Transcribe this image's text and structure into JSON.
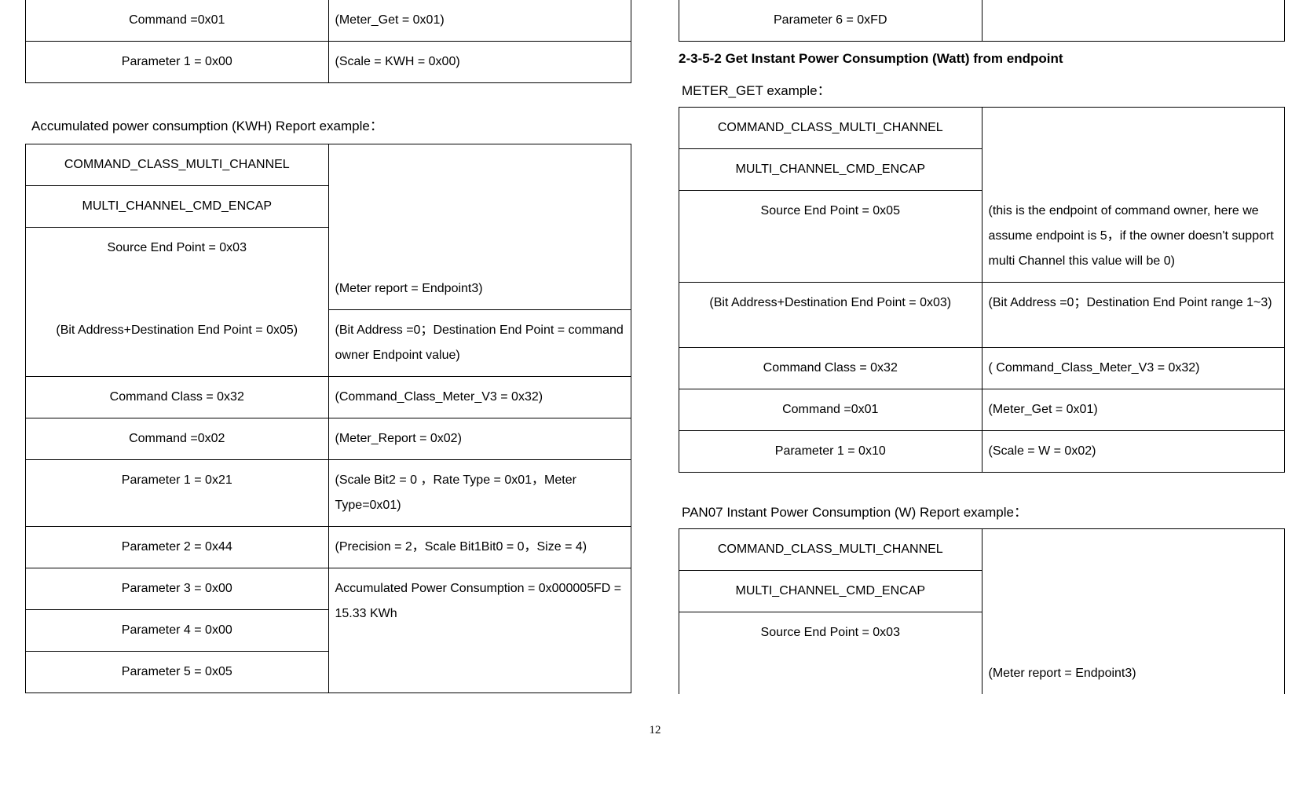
{
  "leftTop": {
    "r1c1": "Command =0x01",
    "r1c2": "(Meter_Get = 0x01)",
    "r2c1": "Parameter 1 = 0x00",
    "r2c2": "(Scale = KWH = 0x00)"
  },
  "leftCaption": "Accumulated power consumption (KWH) Report example：",
  "leftTable": {
    "r1c1": "COMMAND_CLASS_MULTI_CHANNEL",
    "r2c1": "MULTI_CHANNEL_CMD_ENCAP",
    "r3c1": "Source End Point = 0x03",
    "r3c2": "(Meter report = Endpoint3)",
    "r4c1": "(Bit Address+Destination End Point = 0x05)",
    "r4c2": "(Bit Address =0；Destination End Point = command owner Endpoint value)",
    "r5c1": "Command Class = 0x32",
    "r5c2": "(Command_Class_Meter_V3 = 0x32)",
    "r6c1": "Command =0x02",
    "r6c2": "(Meter_Report = 0x02)",
    "r7c1": "Parameter 1 = 0x21",
    "r7c2": "(Scale Bit2 = 0 ，Rate Type = 0x01，Meter Type=0x01)",
    "r8c1": "Parameter 2 = 0x44",
    "r8c2": "(Precision = 2，Scale Bit1Bit0 = 0，Size = 4)",
    "r9c1": "Parameter 3 = 0x00",
    "r9c2": "Accumulated Power Consumption = 0x000005FD = 15.33 KWh",
    "r10c1": "Parameter 4 = 0x00",
    "r11c1": "Parameter 5 = 0x05"
  },
  "rightTop": {
    "r1c1": "Parameter 6 = 0xFD"
  },
  "heading": "2-3-5-2 Get Instant Power Consumption (Watt) from endpoint",
  "subcaption1": "METER_GET example：",
  "rightTable1": {
    "r1c1": "COMMAND_CLASS_MULTI_CHANNEL",
    "r2c1": "MULTI_CHANNEL_CMD_ENCAP",
    "r3c1": "Source End Point = 0x05",
    "r3c2": "(this is the endpoint of command owner, here we assume endpoint is 5，if the owner doesn't support multi Channel this value will be 0)",
    "r4c1": "(Bit Address+Destination End Point = 0x03)",
    "r4c2": "(Bit Address =0；Destination End Point range 1~3)",
    "r5c1": "Command Class = 0x32",
    "r5c2": "( Command_Class_Meter_V3 = 0x32)",
    "r6c1": "Command =0x01",
    "r6c2": "(Meter_Get = 0x01)",
    "r7c1": "Parameter 1 = 0x10",
    "r7c2": "(Scale = W = 0x02)"
  },
  "subcaption2": "PAN07 Instant Power Consumption (W) Report example：",
  "rightTable2": {
    "r1c1": "COMMAND_CLASS_MULTI_CHANNEL",
    "r2c1": "MULTI_CHANNEL_CMD_ENCAP",
    "r3c1": "Source End Point = 0x03",
    "r3c2": "(Meter report = Endpoint3)"
  },
  "pageNumber": "12"
}
